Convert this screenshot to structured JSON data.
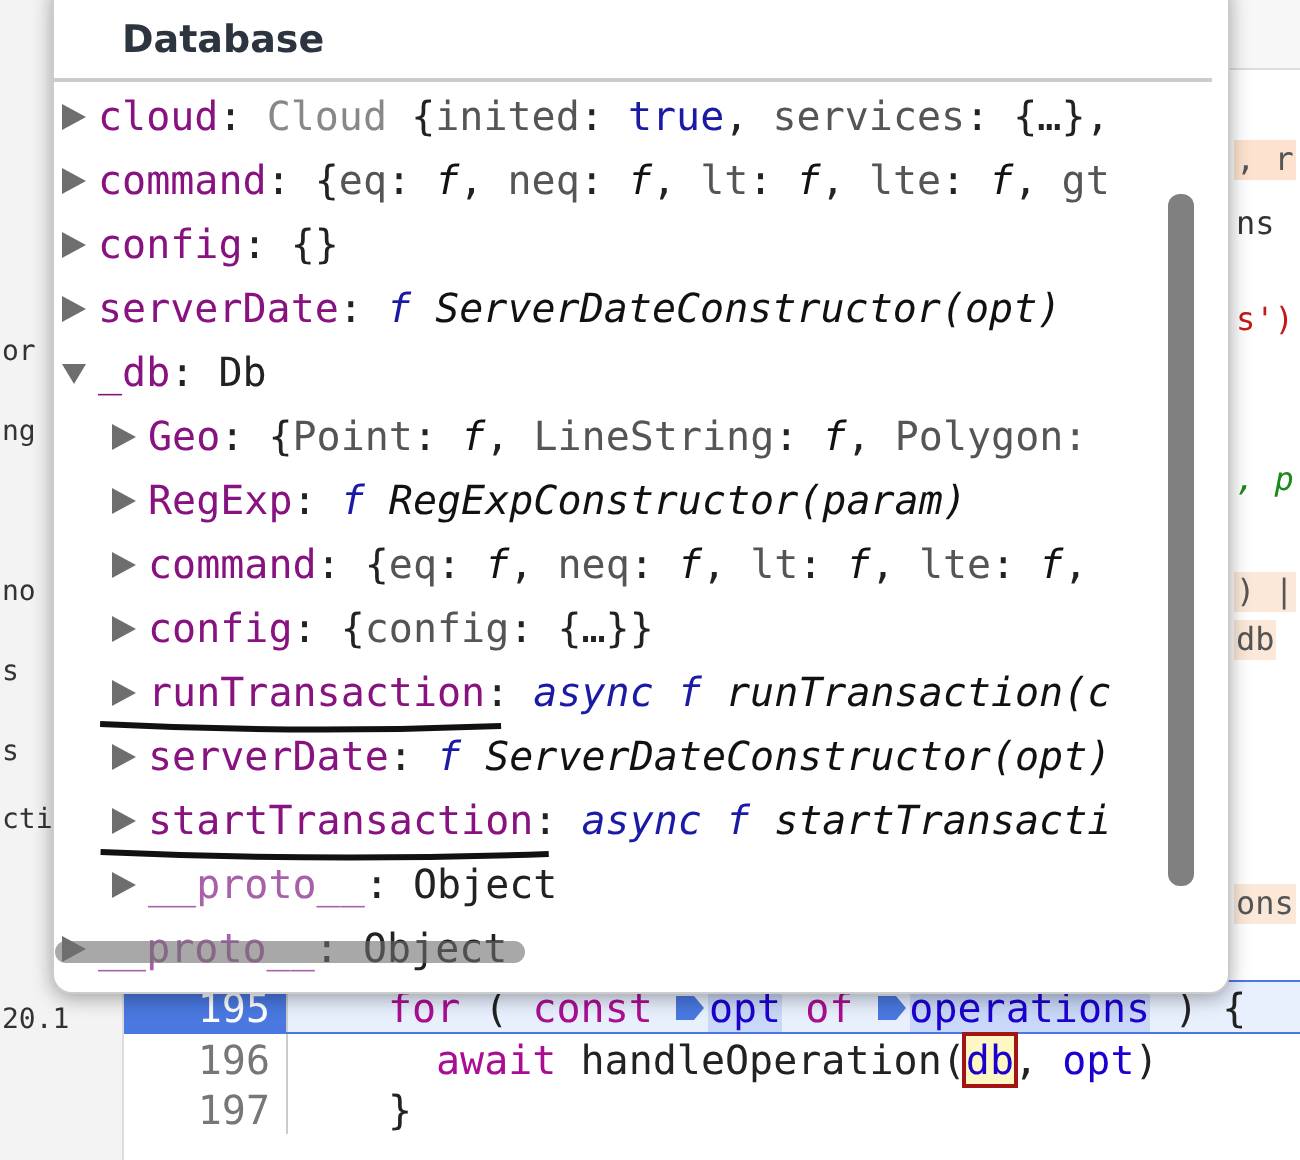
{
  "popover": {
    "title": "Database",
    "rows": [
      {
        "name": "cloud",
        "expanded": false,
        "dimmed": false,
        "value": [
          {
            "text": ": ",
            "kind": "plain"
          },
          {
            "text": "Cloud",
            "kind": "class"
          },
          {
            "text": " {",
            "kind": "plain"
          },
          {
            "text": "inited",
            "kind": "dim"
          },
          {
            "text": ": ",
            "kind": "plain"
          },
          {
            "text": "true",
            "kind": "bool"
          },
          {
            "text": ", ",
            "kind": "plain"
          },
          {
            "text": "services",
            "kind": "dim"
          },
          {
            "text": ": {…},",
            "kind": "plain"
          }
        ]
      },
      {
        "name": "command",
        "expanded": false,
        "dimmed": false,
        "value": [
          {
            "text": ": {",
            "kind": "plain"
          },
          {
            "text": "eq",
            "kind": "dim"
          },
          {
            "text": ": ",
            "kind": "plain"
          },
          {
            "text": "f",
            "kind": "fnp"
          },
          {
            "text": ", ",
            "kind": "plain"
          },
          {
            "text": "neq",
            "kind": "dim"
          },
          {
            "text": ": ",
            "kind": "plain"
          },
          {
            "text": "f",
            "kind": "fnp"
          },
          {
            "text": ", ",
            "kind": "plain"
          },
          {
            "text": "lt",
            "kind": "dim"
          },
          {
            "text": ": ",
            "kind": "plain"
          },
          {
            "text": "f",
            "kind": "fnp"
          },
          {
            "text": ", ",
            "kind": "plain"
          },
          {
            "text": "lte",
            "kind": "dim"
          },
          {
            "text": ": ",
            "kind": "plain"
          },
          {
            "text": "f",
            "kind": "fnp"
          },
          {
            "text": ", ",
            "kind": "plain"
          },
          {
            "text": "gt",
            "kind": "dim"
          }
        ]
      },
      {
        "name": "config",
        "expanded": false,
        "dimmed": false,
        "value": [
          {
            "text": ": {}",
            "kind": "plain"
          }
        ]
      },
      {
        "name": "serverDate",
        "expanded": false,
        "dimmed": false,
        "value": [
          {
            "text": ": ",
            "kind": "plain"
          },
          {
            "text": "f",
            "kind": "fn"
          },
          {
            "text": " ServerDateConstructor(opt)",
            "kind": "sig"
          }
        ]
      },
      {
        "name": "_db",
        "expanded": true,
        "dimmed": false,
        "value": [
          {
            "text": ": Db",
            "kind": "plain"
          }
        ],
        "children": [
          {
            "name": "Geo",
            "expanded": false,
            "dimmed": false,
            "value": [
              {
                "text": ": {",
                "kind": "plain"
              },
              {
                "text": "Point",
                "kind": "dim"
              },
              {
                "text": ": ",
                "kind": "plain"
              },
              {
                "text": "f",
                "kind": "fnp"
              },
              {
                "text": ", ",
                "kind": "plain"
              },
              {
                "text": "LineString",
                "kind": "dim"
              },
              {
                "text": ": ",
                "kind": "plain"
              },
              {
                "text": "f",
                "kind": "fnp"
              },
              {
                "text": ", ",
                "kind": "plain"
              },
              {
                "text": "Polygon:",
                "kind": "dim"
              }
            ]
          },
          {
            "name": "RegExp",
            "expanded": false,
            "dimmed": false,
            "value": [
              {
                "text": ": ",
                "kind": "plain"
              },
              {
                "text": "f",
                "kind": "fn"
              },
              {
                "text": " RegExpConstructor(param)",
                "kind": "sig"
              }
            ]
          },
          {
            "name": "command",
            "expanded": false,
            "dimmed": false,
            "value": [
              {
                "text": ": {",
                "kind": "plain"
              },
              {
                "text": "eq",
                "kind": "dim"
              },
              {
                "text": ": ",
                "kind": "plain"
              },
              {
                "text": "f",
                "kind": "fnp"
              },
              {
                "text": ", ",
                "kind": "plain"
              },
              {
                "text": "neq",
                "kind": "dim"
              },
              {
                "text": ": ",
                "kind": "plain"
              },
              {
                "text": "f",
                "kind": "fnp"
              },
              {
                "text": ", ",
                "kind": "plain"
              },
              {
                "text": "lt",
                "kind": "dim"
              },
              {
                "text": ": ",
                "kind": "plain"
              },
              {
                "text": "f",
                "kind": "fnp"
              },
              {
                "text": ", ",
                "kind": "plain"
              },
              {
                "text": "lte",
                "kind": "dim"
              },
              {
                "text": ": ",
                "kind": "plain"
              },
              {
                "text": "f",
                "kind": "fnp"
              },
              {
                "text": ",",
                "kind": "plain"
              }
            ]
          },
          {
            "name": "config",
            "expanded": false,
            "dimmed": false,
            "value": [
              {
                "text": ": {",
                "kind": "plain"
              },
              {
                "text": "config",
                "kind": "dim"
              },
              {
                "text": ": {…}}",
                "kind": "plain"
              }
            ]
          },
          {
            "name": "runTransaction",
            "expanded": false,
            "dimmed": false,
            "underlined": true,
            "value": [
              {
                "text": ": ",
                "kind": "plain"
              },
              {
                "text": "async f",
                "kind": "fn"
              },
              {
                "text": " runTransaction(c",
                "kind": "sig"
              }
            ]
          },
          {
            "name": "serverDate",
            "expanded": false,
            "dimmed": false,
            "value": [
              {
                "text": ": ",
                "kind": "plain"
              },
              {
                "text": "f",
                "kind": "fn"
              },
              {
                "text": " ServerDateConstructor(opt)",
                "kind": "sig"
              }
            ]
          },
          {
            "name": "startTransaction",
            "expanded": false,
            "dimmed": false,
            "underlined": true,
            "value": [
              {
                "text": ": ",
                "kind": "plain"
              },
              {
                "text": "async f",
                "kind": "fn"
              },
              {
                "text": " startTransacti",
                "kind": "sig"
              }
            ]
          },
          {
            "name": "__proto__",
            "expanded": false,
            "dimmed": true,
            "value": [
              {
                "text": ": Object",
                "kind": "plain"
              }
            ]
          }
        ]
      },
      {
        "name": "__proto__",
        "expanded": false,
        "dimmed": true,
        "struck_out": true,
        "value": [
          {
            "text": ": Object",
            "kind": "plain"
          }
        ]
      }
    ]
  },
  "editor": {
    "lines": [
      {
        "number": "195",
        "current": true,
        "code": [
          {
            "text": "for",
            "kind": "kw"
          },
          {
            "text": " (",
            "kind": "plain"
          },
          {
            "text": "const",
            "kind": "kw"
          },
          {
            "text": "opt",
            "kind": "marked"
          },
          {
            "text": "of",
            "kind": "kw"
          },
          {
            "text": "operations",
            "kind": "marked"
          },
          {
            "text": ") {",
            "kind": "plain"
          }
        ]
      },
      {
        "number": "196",
        "current": false,
        "code": [
          {
            "text": "await",
            "kind": "kw"
          },
          {
            "text": " handleOperation(",
            "kind": "plain"
          },
          {
            "text": "db",
            "kind": "hover"
          },
          {
            "text": ", ",
            "kind": "plain"
          },
          {
            "text": "opt",
            "kind": "var"
          },
          {
            "text": ")",
            "kind": "plain"
          }
        ]
      },
      {
        "number": "197",
        "current": false,
        "code": [
          {
            "text": "}",
            "kind": "plain"
          }
        ]
      }
    ],
    "left_fragments": [
      "or",
      "ng",
      "no",
      "s",
      "s",
      "cti",
      "20.1"
    ],
    "right_fragments": [
      {
        "text": ", r",
        "kind": "orange"
      },
      {
        "text": "ns",
        "kind": "plain"
      },
      {
        "text": "s')",
        "kind": "string"
      },
      {
        "text": ", p",
        "kind": "green"
      },
      {
        "text": ") |",
        "kind": "beige"
      },
      {
        "text": "db",
        "kind": "beige"
      },
      {
        "text": "ons",
        "kind": "beige"
      }
    ]
  }
}
